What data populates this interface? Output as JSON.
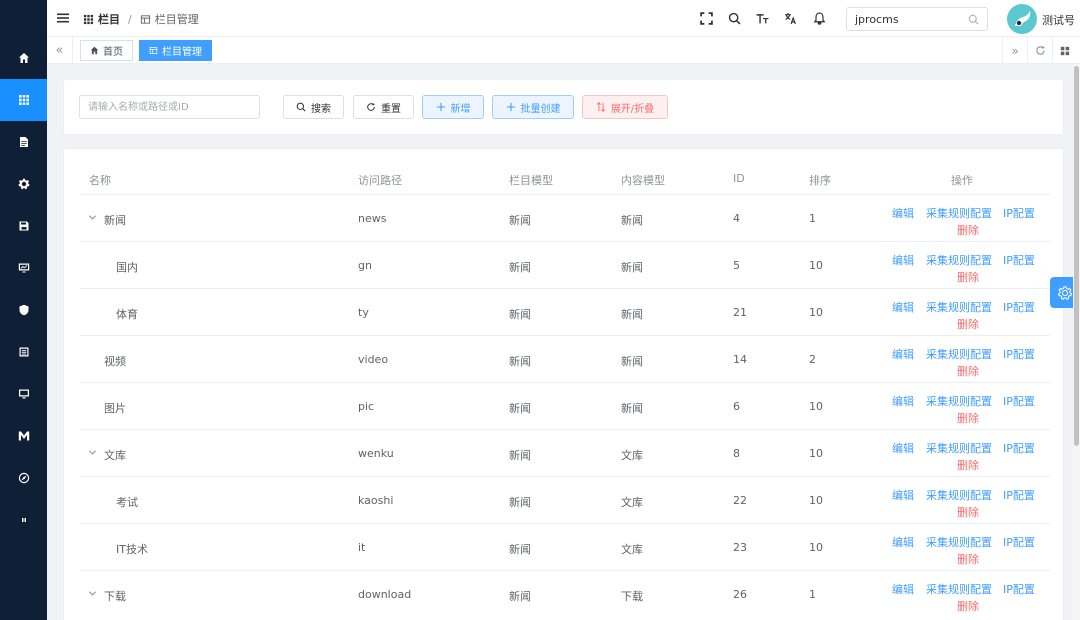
{
  "sidebar": {
    "items": [
      {
        "icon": "home-icon"
      },
      {
        "icon": "grid-icon",
        "active": true
      },
      {
        "icon": "document-icon"
      },
      {
        "icon": "gear-icon"
      },
      {
        "icon": "save-icon"
      },
      {
        "icon": "monitor-chart-icon"
      },
      {
        "icon": "shield-icon"
      },
      {
        "icon": "list-icon"
      },
      {
        "icon": "desktop-icon"
      },
      {
        "icon": "m-logo-icon"
      },
      {
        "icon": "compass-icon"
      },
      {
        "icon": "bars-icon"
      }
    ]
  },
  "header": {
    "breadcrumb": [
      "栏目",
      "栏目管理"
    ],
    "site_select_value": "jprocms",
    "username": "测试号"
  },
  "tags": {
    "items": [
      "首页",
      "栏目管理"
    ],
    "active_index": 1
  },
  "search": {
    "placeholder": "请输入名称或路径或ID",
    "value": "",
    "buttons": {
      "search": "搜索",
      "reset": "重置",
      "add": "新增",
      "batch_create": "批量创建",
      "expand_collapse": "展开/折叠"
    }
  },
  "table": {
    "columns": [
      "名称",
      "访问路径",
      "栏目模型",
      "内容模型",
      "ID",
      "排序",
      "操作"
    ],
    "actions": {
      "edit": "编辑",
      "collect": "采集规则配置",
      "ip": "IP配置",
      "delete": "删除"
    },
    "rows": [
      {
        "name": "新闻",
        "path": "news",
        "channel_model": "新闻",
        "content_model": "新闻",
        "id": "4",
        "sort": "1",
        "expandable": true,
        "level": 0
      },
      {
        "name": "国内",
        "path": "gn",
        "channel_model": "新闻",
        "content_model": "新闻",
        "id": "5",
        "sort": "10",
        "expandable": false,
        "level": 1
      },
      {
        "name": "体育",
        "path": "ty",
        "channel_model": "新闻",
        "content_model": "新闻",
        "id": "21",
        "sort": "10",
        "expandable": false,
        "level": 1
      },
      {
        "name": "视频",
        "path": "video",
        "channel_model": "新闻",
        "content_model": "新闻",
        "id": "14",
        "sort": "2",
        "expandable": false,
        "level": 0
      },
      {
        "name": "图片",
        "path": "pic",
        "channel_model": "新闻",
        "content_model": "新闻",
        "id": "6",
        "sort": "10",
        "expandable": false,
        "level": 0
      },
      {
        "name": "文库",
        "path": "wenku",
        "channel_model": "新闻",
        "content_model": "文库",
        "id": "8",
        "sort": "10",
        "expandable": true,
        "level": 0
      },
      {
        "name": "考试",
        "path": "kaoshi",
        "channel_model": "新闻",
        "content_model": "文库",
        "id": "22",
        "sort": "10",
        "expandable": false,
        "level": 1
      },
      {
        "name": "IT技术",
        "path": "it",
        "channel_model": "新闻",
        "content_model": "文库",
        "id": "23",
        "sort": "10",
        "expandable": false,
        "level": 1
      },
      {
        "name": "下载",
        "path": "download",
        "channel_model": "新闻",
        "content_model": "下载",
        "id": "26",
        "sort": "1",
        "expandable": true,
        "level": 0
      }
    ]
  },
  "colors": {
    "sidebar_bg": "#0f1f35",
    "accent": "#409eff",
    "danger": "#f56c6c"
  }
}
